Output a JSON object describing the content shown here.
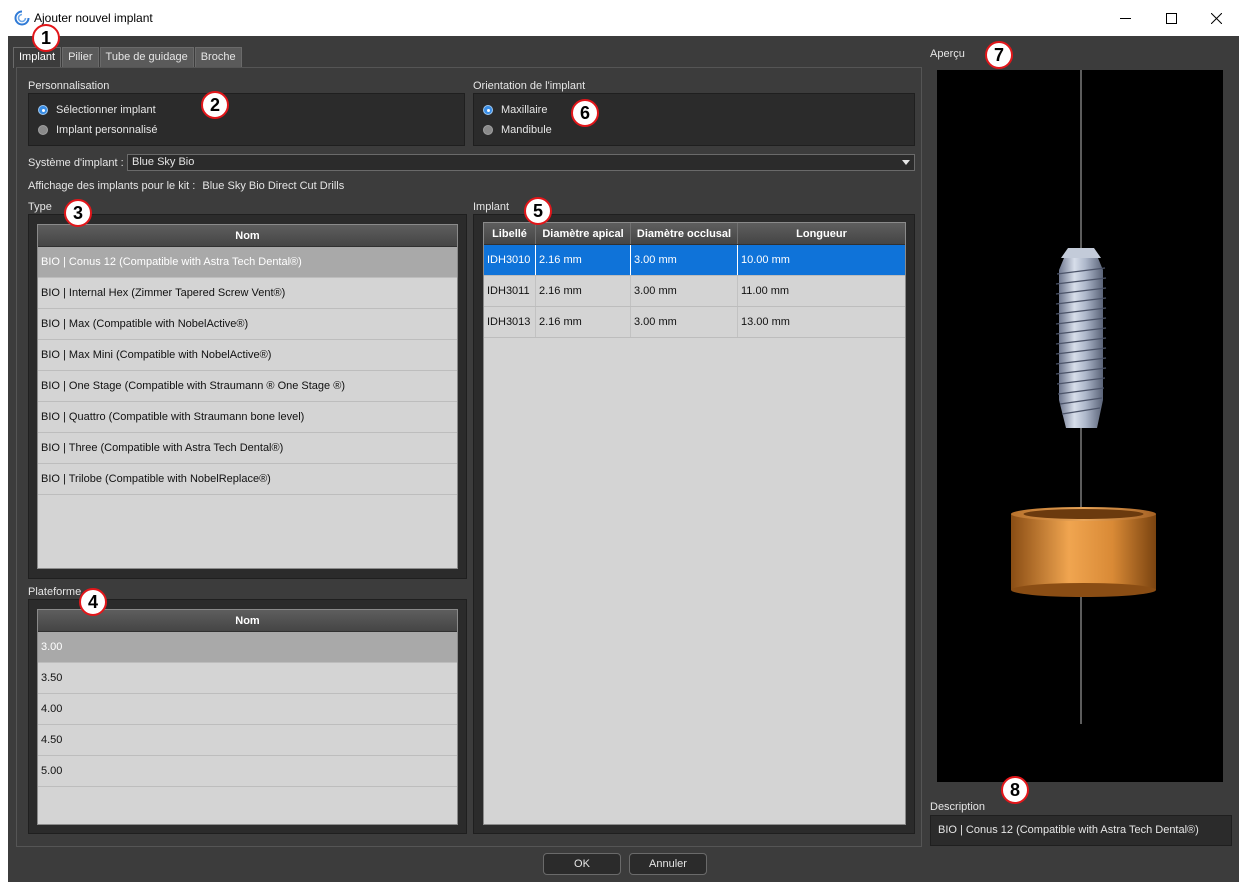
{
  "window": {
    "title": "Ajouter nouvel implant",
    "controls": [
      "minimize",
      "maximize",
      "close"
    ]
  },
  "tabs": [
    {
      "label": "Implant",
      "active": true
    },
    {
      "label": "Pilier",
      "active": false
    },
    {
      "label": "Tube de guidage",
      "active": false
    },
    {
      "label": "Broche",
      "active": false
    }
  ],
  "personnalisation": {
    "label": "Personnalisation",
    "options": [
      {
        "label": "Sélectionner implant",
        "checked": true
      },
      {
        "label": "Implant personnalisé",
        "checked": false
      }
    ]
  },
  "orientation": {
    "label": "Orientation de l'implant",
    "options": [
      {
        "label": "Maxillaire",
        "checked": true
      },
      {
        "label": "Mandibule",
        "checked": false
      }
    ]
  },
  "systeme": {
    "label": "Système d'implant :",
    "value": "Blue Sky Bio"
  },
  "kit_info": {
    "label": "Affichage des implants pour le kit :",
    "value": "Blue Sky Bio Direct Cut Drills"
  },
  "type": {
    "label": "Type",
    "header": "Nom",
    "rows": [
      "BIO | Conus 12 (Compatible with Astra Tech Dental®)",
      "BIO | Internal Hex (Zimmer Tapered Screw Vent®)",
      "BIO | Max (Compatible with NobelActive®)",
      "BIO | Max Mini (Compatible with NobelActive®)",
      "BIO | One Stage (Compatible with Straumann ® One Stage ®)",
      "BIO | Quattro (Compatible with Straumann bone level)",
      "BIO | Three (Compatible with Astra Tech Dental®)",
      "BIO | Trilobe (Compatible with NobelReplace®)"
    ],
    "selected_index": 0
  },
  "plateforme": {
    "label": "Plateforme",
    "header": "Nom",
    "rows": [
      "3.00",
      "3.50",
      "4.00",
      "4.50",
      "5.00"
    ],
    "selected_index": 0
  },
  "implant": {
    "label": "Implant",
    "headers": [
      "Libellé",
      "Diamètre apical",
      "Diamètre occlusal",
      "Longueur"
    ],
    "rows": [
      [
        "IDH3010",
        "2.16 mm",
        "3.00 mm",
        "10.00 mm"
      ],
      [
        "IDH3011",
        "2.16 mm",
        "3.00 mm",
        "11.00 mm"
      ],
      [
        "IDH3013",
        "2.16 mm",
        "3.00 mm",
        "13.00 mm"
      ]
    ],
    "selected_index": 0
  },
  "apercu": {
    "label": "Aperçu"
  },
  "description": {
    "label": "Description",
    "value": "BIO | Conus 12 (Compatible with Astra Tech Dental®)"
  },
  "buttons": {
    "ok": "OK",
    "cancel": "Annuler"
  },
  "callouts": [
    "1",
    "2",
    "3",
    "4",
    "5",
    "6",
    "7",
    "8"
  ],
  "colors": {
    "callout_border": "#e2161a",
    "selection_blue": "#0f73d9",
    "sleeve_copper": "#c87d2c",
    "implant_steel": "#a8b2c4"
  }
}
